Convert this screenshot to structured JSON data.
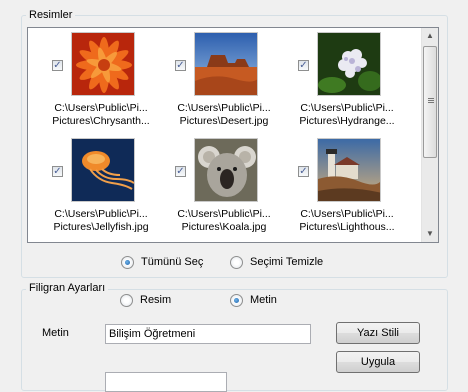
{
  "images_group": {
    "title": "Resimler",
    "items": [
      {
        "line1": "C:\\Users\\Public\\Pi...",
        "line2": "Pictures\\Chrysanth...",
        "checked": true,
        "image": "chrysanthemum-photo"
      },
      {
        "line1": "C:\\Users\\Public\\Pi...",
        "line2": "Pictures\\Desert.jpg",
        "checked": true,
        "image": "desert-photo"
      },
      {
        "line1": "C:\\Users\\Public\\Pi...",
        "line2": "Pictures\\Hydrange...",
        "checked": true,
        "image": "hydrangea-photo"
      },
      {
        "line1": "C:\\Users\\Public\\Pi...",
        "line2": "Pictures\\Jellyfish.jpg",
        "checked": true,
        "image": "jellyfish-photo"
      },
      {
        "line1": "C:\\Users\\Public\\Pi...",
        "line2": "Pictures\\Koala.jpg",
        "checked": true,
        "image": "koala-photo"
      },
      {
        "line1": "C:\\Users\\Public\\Pi...",
        "line2": "Pictures\\Lighthous...",
        "checked": true,
        "image": "lighthouse-photo"
      }
    ],
    "select_all_label": "Tümünü Seç",
    "select_all_selected": true,
    "clear_selection_label": "Seçimi Temizle",
    "clear_selection_selected": false
  },
  "watermark_group": {
    "title": "Filigran Ayarları",
    "image_option_label": "Resim",
    "image_option_selected": false,
    "text_option_label": "Metin",
    "text_option_selected": true,
    "text_field_label": "Metin",
    "text_field_value": "Bilişim Öğretmeni",
    "font_button_label": "Yazı Stili",
    "apply_button_label": "Uygula"
  }
}
